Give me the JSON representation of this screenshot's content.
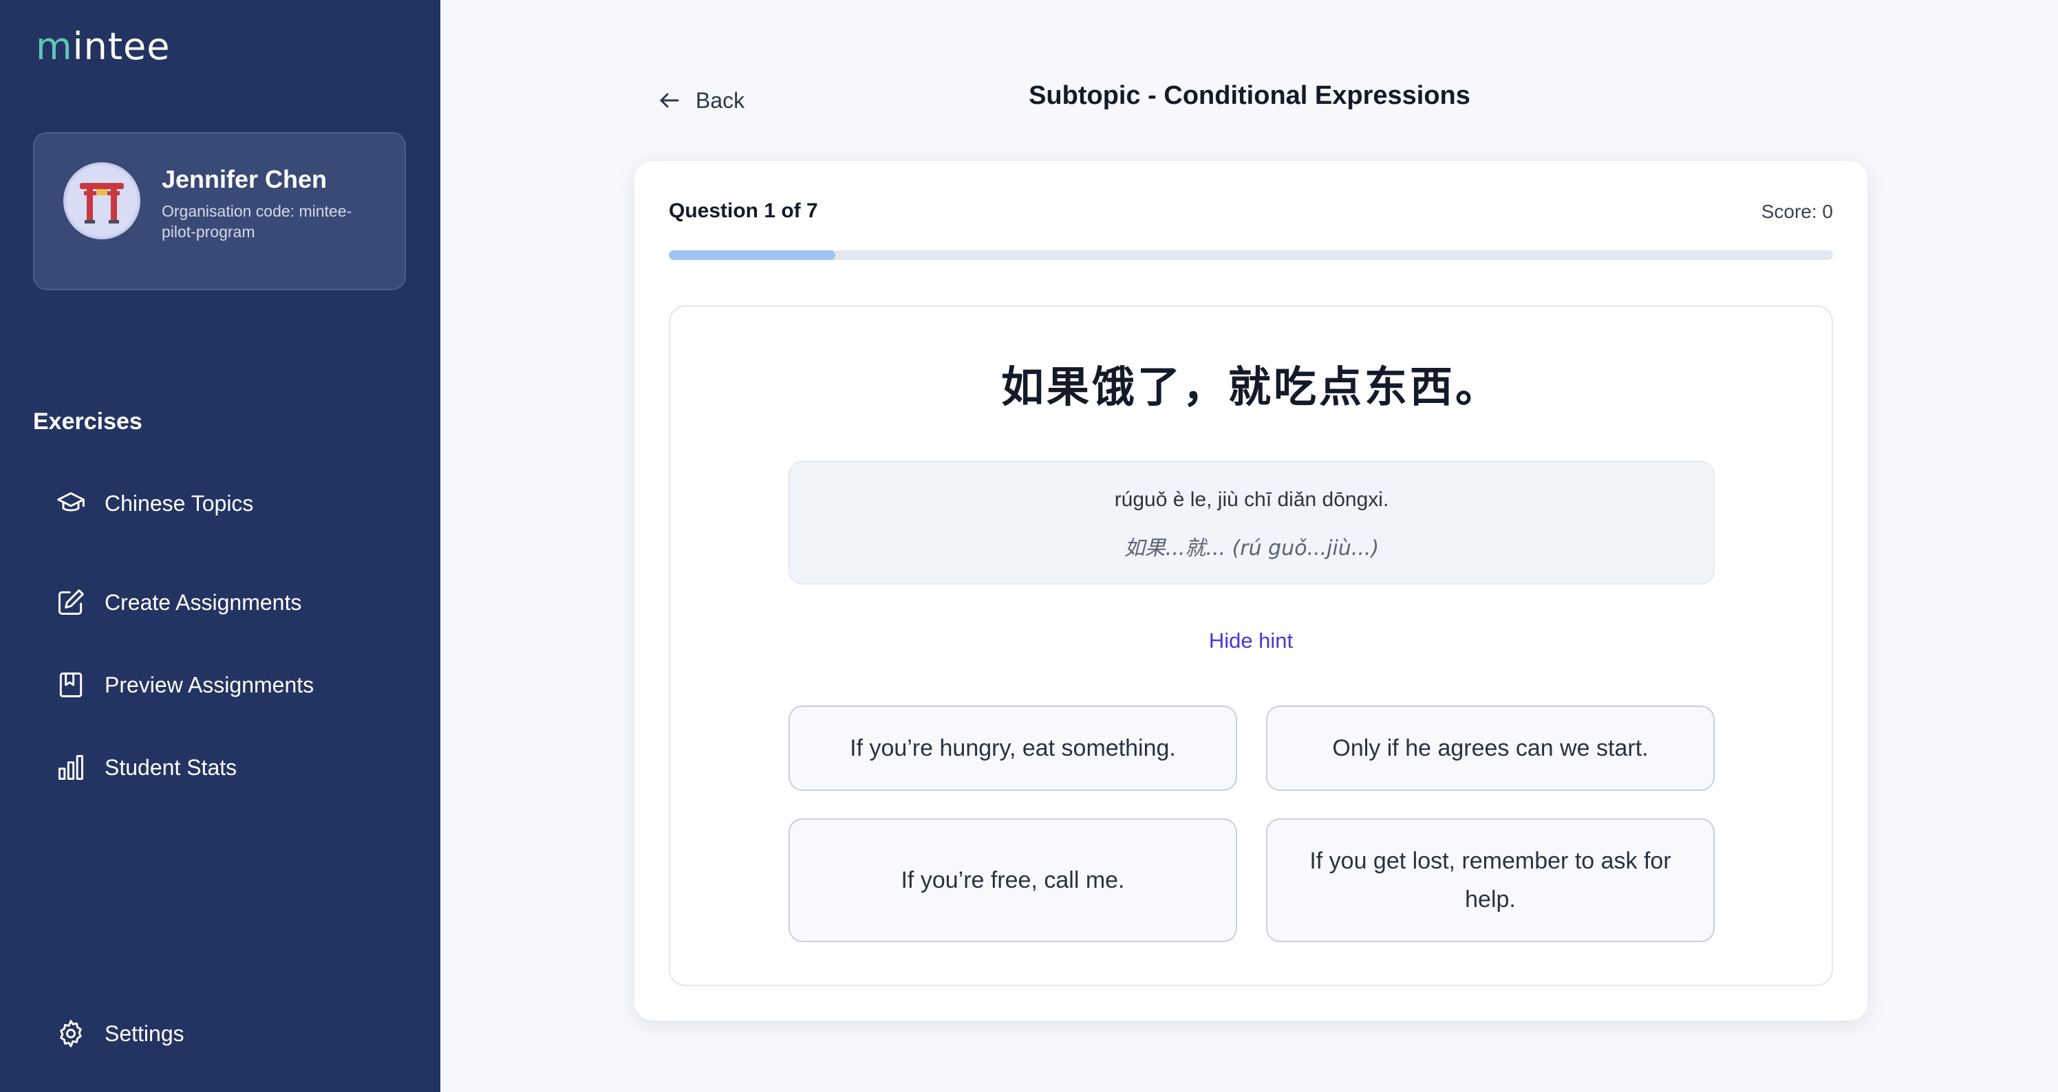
{
  "app": {
    "logo_text_m": "m",
    "logo_text_rest": "intee"
  },
  "profile": {
    "name": "Jennifer Chen",
    "org": "Organisation code: mintee-pilot-program",
    "avatar_icon": "torii-gate-icon"
  },
  "sidebar": {
    "section_title": "Exercises",
    "items": [
      {
        "label": "Chinese Topics",
        "icon": "graduation-cap-icon"
      },
      {
        "label": "Create Assignments",
        "icon": "pencil-square-icon"
      },
      {
        "label": "Preview Assignments",
        "icon": "bookmark-icon"
      },
      {
        "label": "Student Stats",
        "icon": "bar-chart-icon"
      }
    ],
    "settings_label": "Settings"
  },
  "header": {
    "back_label": "Back",
    "title": "Subtopic - Conditional Expressions"
  },
  "quiz": {
    "question_counter": "Question 1 of 7",
    "score": "Score: 0",
    "progress_fraction": 0.143,
    "chinese_sentence": "如果饿了，就吃点东西。",
    "pinyin": "rúguǒ è le, jiù chī diǎn dōngxi.",
    "pattern": "如果...就... (rú guǒ...jiù...)",
    "hide_hint_label": "Hide hint",
    "answers": [
      "If you’re hungry, eat something.",
      "Only if he agrees can we start.",
      "If you’re free, call me.",
      "If you get lost, remember to ask for help."
    ]
  },
  "colors": {
    "sidebar_bg": "#233462",
    "accent_link": "#4a36d6",
    "progress_fill": "#9ec4f2",
    "logo_accent": "#5fc7b1"
  }
}
